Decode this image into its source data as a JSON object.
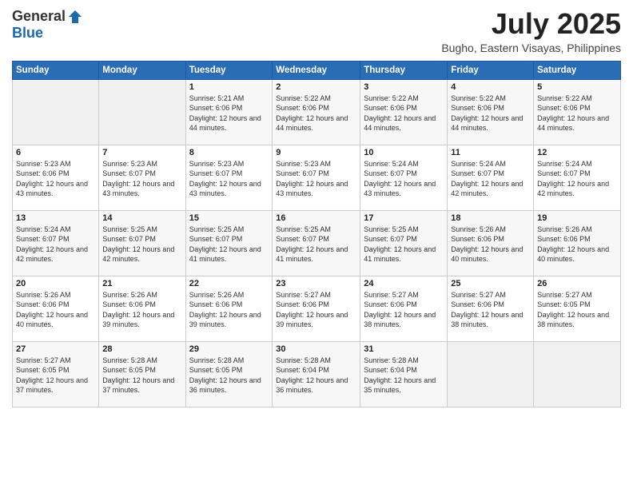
{
  "logo": {
    "general": "General",
    "blue": "Blue"
  },
  "header": {
    "title": "July 2025",
    "subtitle": "Bugho, Eastern Visayas, Philippines"
  },
  "weekdays": [
    "Sunday",
    "Monday",
    "Tuesday",
    "Wednesday",
    "Thursday",
    "Friday",
    "Saturday"
  ],
  "weeks": [
    [
      {
        "day": "",
        "info": ""
      },
      {
        "day": "",
        "info": ""
      },
      {
        "day": "1",
        "info": "Sunrise: 5:21 AM\nSunset: 6:06 PM\nDaylight: 12 hours and 44 minutes."
      },
      {
        "day": "2",
        "info": "Sunrise: 5:22 AM\nSunset: 6:06 PM\nDaylight: 12 hours and 44 minutes."
      },
      {
        "day": "3",
        "info": "Sunrise: 5:22 AM\nSunset: 6:06 PM\nDaylight: 12 hours and 44 minutes."
      },
      {
        "day": "4",
        "info": "Sunrise: 5:22 AM\nSunset: 6:06 PM\nDaylight: 12 hours and 44 minutes."
      },
      {
        "day": "5",
        "info": "Sunrise: 5:22 AM\nSunset: 6:06 PM\nDaylight: 12 hours and 44 minutes."
      }
    ],
    [
      {
        "day": "6",
        "info": "Sunrise: 5:23 AM\nSunset: 6:06 PM\nDaylight: 12 hours and 43 minutes."
      },
      {
        "day": "7",
        "info": "Sunrise: 5:23 AM\nSunset: 6:07 PM\nDaylight: 12 hours and 43 minutes."
      },
      {
        "day": "8",
        "info": "Sunrise: 5:23 AM\nSunset: 6:07 PM\nDaylight: 12 hours and 43 minutes."
      },
      {
        "day": "9",
        "info": "Sunrise: 5:23 AM\nSunset: 6:07 PM\nDaylight: 12 hours and 43 minutes."
      },
      {
        "day": "10",
        "info": "Sunrise: 5:24 AM\nSunset: 6:07 PM\nDaylight: 12 hours and 43 minutes."
      },
      {
        "day": "11",
        "info": "Sunrise: 5:24 AM\nSunset: 6:07 PM\nDaylight: 12 hours and 42 minutes."
      },
      {
        "day": "12",
        "info": "Sunrise: 5:24 AM\nSunset: 6:07 PM\nDaylight: 12 hours and 42 minutes."
      }
    ],
    [
      {
        "day": "13",
        "info": "Sunrise: 5:24 AM\nSunset: 6:07 PM\nDaylight: 12 hours and 42 minutes."
      },
      {
        "day": "14",
        "info": "Sunrise: 5:25 AM\nSunset: 6:07 PM\nDaylight: 12 hours and 42 minutes."
      },
      {
        "day": "15",
        "info": "Sunrise: 5:25 AM\nSunset: 6:07 PM\nDaylight: 12 hours and 41 minutes."
      },
      {
        "day": "16",
        "info": "Sunrise: 5:25 AM\nSunset: 6:07 PM\nDaylight: 12 hours and 41 minutes."
      },
      {
        "day": "17",
        "info": "Sunrise: 5:25 AM\nSunset: 6:07 PM\nDaylight: 12 hours and 41 minutes."
      },
      {
        "day": "18",
        "info": "Sunrise: 5:26 AM\nSunset: 6:06 PM\nDaylight: 12 hours and 40 minutes."
      },
      {
        "day": "19",
        "info": "Sunrise: 5:26 AM\nSunset: 6:06 PM\nDaylight: 12 hours and 40 minutes."
      }
    ],
    [
      {
        "day": "20",
        "info": "Sunrise: 5:26 AM\nSunset: 6:06 PM\nDaylight: 12 hours and 40 minutes."
      },
      {
        "day": "21",
        "info": "Sunrise: 5:26 AM\nSunset: 6:06 PM\nDaylight: 12 hours and 39 minutes."
      },
      {
        "day": "22",
        "info": "Sunrise: 5:26 AM\nSunset: 6:06 PM\nDaylight: 12 hours and 39 minutes."
      },
      {
        "day": "23",
        "info": "Sunrise: 5:27 AM\nSunset: 6:06 PM\nDaylight: 12 hours and 39 minutes."
      },
      {
        "day": "24",
        "info": "Sunrise: 5:27 AM\nSunset: 6:06 PM\nDaylight: 12 hours and 38 minutes."
      },
      {
        "day": "25",
        "info": "Sunrise: 5:27 AM\nSunset: 6:06 PM\nDaylight: 12 hours and 38 minutes."
      },
      {
        "day": "26",
        "info": "Sunrise: 5:27 AM\nSunset: 6:05 PM\nDaylight: 12 hours and 38 minutes."
      }
    ],
    [
      {
        "day": "27",
        "info": "Sunrise: 5:27 AM\nSunset: 6:05 PM\nDaylight: 12 hours and 37 minutes."
      },
      {
        "day": "28",
        "info": "Sunrise: 5:28 AM\nSunset: 6:05 PM\nDaylight: 12 hours and 37 minutes."
      },
      {
        "day": "29",
        "info": "Sunrise: 5:28 AM\nSunset: 6:05 PM\nDaylight: 12 hours and 36 minutes."
      },
      {
        "day": "30",
        "info": "Sunrise: 5:28 AM\nSunset: 6:04 PM\nDaylight: 12 hours and 36 minutes."
      },
      {
        "day": "31",
        "info": "Sunrise: 5:28 AM\nSunset: 6:04 PM\nDaylight: 12 hours and 35 minutes."
      },
      {
        "day": "",
        "info": ""
      },
      {
        "day": "",
        "info": ""
      }
    ]
  ]
}
